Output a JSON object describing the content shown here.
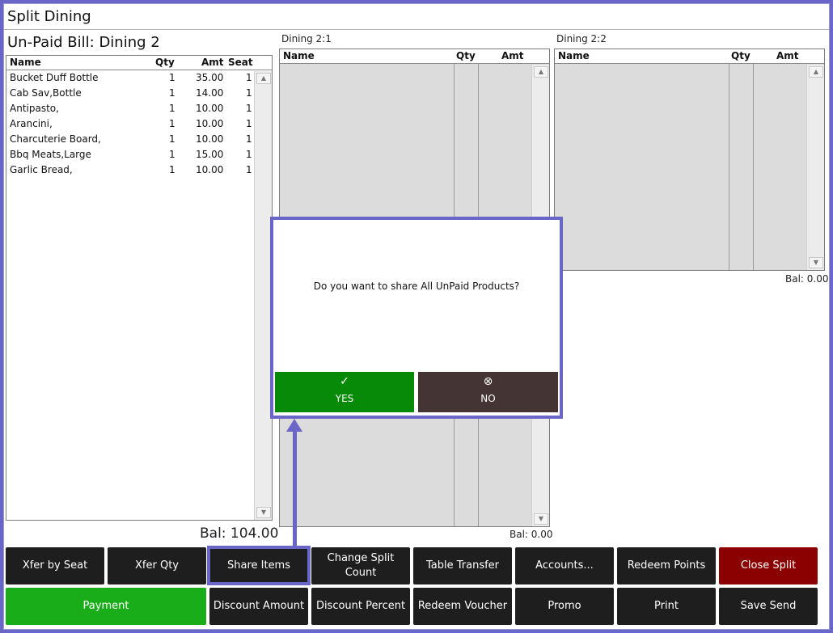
{
  "window": {
    "title": "Split Dining"
  },
  "bill": {
    "heading": "Un-Paid Bill: Dining 2",
    "columns": {
      "name": "Name",
      "qty": "Qty",
      "amt": "Amt",
      "seat": "Seat"
    },
    "rows": [
      {
        "name": "Bucket Duff Bottle",
        "qty": "1",
        "amt": "35.00",
        "seat": "1"
      },
      {
        "name": "Cab Sav,Bottle",
        "qty": "1",
        "amt": "14.00",
        "seat": "1"
      },
      {
        "name": "Antipasto,",
        "qty": "1",
        "amt": "10.00",
        "seat": "1"
      },
      {
        "name": "Arancini,",
        "qty": "1",
        "amt": "10.00",
        "seat": "1"
      },
      {
        "name": "Charcuterie Board,",
        "qty": "1",
        "amt": "10.00",
        "seat": "1"
      },
      {
        "name": "Bbq Meats,Large",
        "qty": "1",
        "amt": "15.00",
        "seat": "1"
      },
      {
        "name": "Garlic Bread,",
        "qty": "1",
        "amt": "10.00",
        "seat": "1"
      }
    ],
    "balance": "Bal: 104.00"
  },
  "splits": [
    {
      "label": "Dining 2:1",
      "columns": {
        "name": "Name",
        "qty": "Qty",
        "amt": "Amt"
      },
      "balance": "Bal: 0.00"
    },
    {
      "label": "Dining 2:2",
      "columns": {
        "name": "Name",
        "qty": "Qty",
        "amt": "Amt"
      },
      "balance": "Bal: 0.00"
    }
  ],
  "dialog": {
    "message": "Do you want to share All UnPaid Products?",
    "yes_icon": "check-icon",
    "yes_glyph": "✓",
    "yes_label": "YES",
    "no_icon": "close-circle-icon",
    "no_glyph": "⊗",
    "no_label": "NO"
  },
  "buttons": {
    "xfer_by_seat": "Xfer by Seat",
    "xfer_qty": "Xfer Qty",
    "share_items": "Share Items",
    "change_split_count_1": "Change Split",
    "change_split_count_2": "Count",
    "table_transfer": "Table Transfer",
    "accounts": "Accounts...",
    "redeem_points": "Redeem Points",
    "close_split": "Close Split",
    "payment": "Payment",
    "discount_amount": "Discount Amount",
    "discount_percent": "Discount Percent",
    "redeem_voucher": "Redeem Voucher",
    "promo": "Promo",
    "print": "Print",
    "save_send": "Save Send"
  },
  "colors": {
    "accent": "#6a66c8",
    "payment": "#1aad1a",
    "close_split": "#8b0000",
    "yes": "#078a07",
    "no": "#453434",
    "button": "#1e1e1e"
  }
}
